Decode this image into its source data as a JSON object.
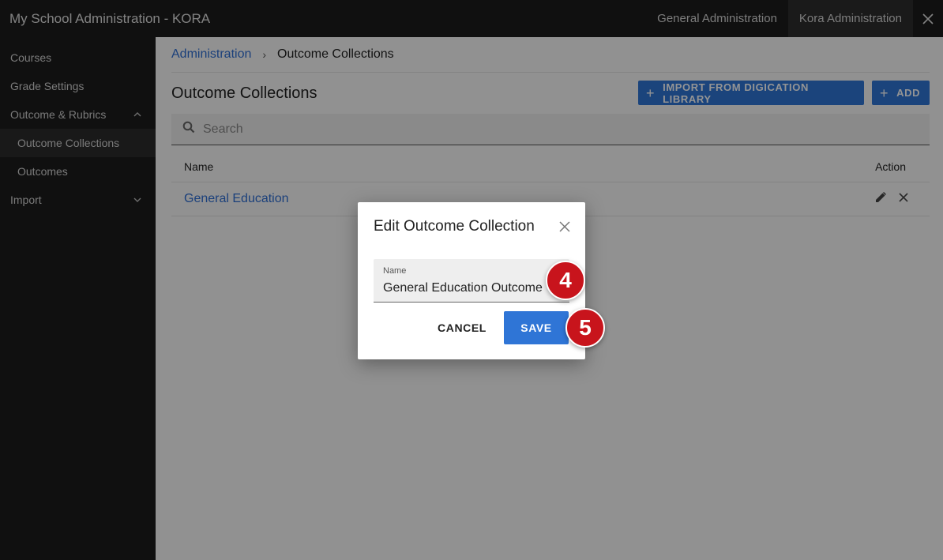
{
  "header": {
    "title": "My School Administration - KORA",
    "tabs": [
      {
        "label": "General Administration"
      },
      {
        "label": "Kora Administration"
      }
    ]
  },
  "sidebar": {
    "items": [
      {
        "label": "Courses"
      },
      {
        "label": "Grade Settings"
      },
      {
        "label": "Outcome & Rubrics"
      },
      {
        "label": "Outcome Collections"
      },
      {
        "label": "Outcomes"
      },
      {
        "label": "Import"
      }
    ]
  },
  "breadcrumb": {
    "root": "Administration",
    "separator": "›",
    "current": "Outcome Collections"
  },
  "page": {
    "title": "Outcome Collections",
    "import_label": "IMPORT FROM DIGICATION LIBRARY",
    "add_label": "ADD",
    "plus": "+",
    "search_placeholder": "Search"
  },
  "table": {
    "columns": {
      "name": "Name",
      "action": "Action"
    },
    "rows": [
      {
        "name": "General Education"
      }
    ]
  },
  "dialog": {
    "title": "Edit Outcome Collection",
    "field_label": "Name",
    "field_value": "General Education Outcome",
    "cancel_label": "CANCEL",
    "save_label": "SAVE"
  },
  "annotations": {
    "step_a": "4",
    "step_b": "5"
  },
  "colors": {
    "accent": "#2f75d6",
    "badge": "#c8141c",
    "topbar": "#1c1c1c"
  }
}
